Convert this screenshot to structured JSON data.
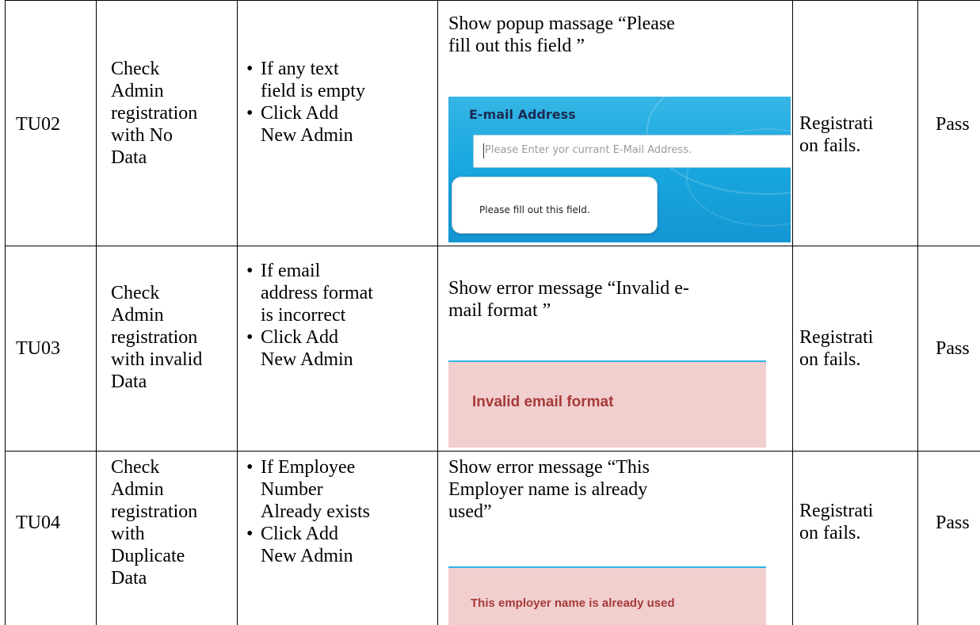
{
  "rows": [
    {
      "id": "TU02",
      "description": "Check\nAdmin\nregistration\nwith  No\nData",
      "steps": [
        "If any text\nfield is empty",
        "Click Add\nNew Admin"
      ],
      "expected": "Show popup massage “Please\nfill out this field ”",
      "screenshot": {
        "field_label": "E-mail Address",
        "placeholder": "Please Enter yor currant E-Mail Address.",
        "popup_text": "Please fill out this field."
      },
      "actual": "Registrati\non fails.",
      "status": "Pass"
    },
    {
      "id": "TU03",
      "description": "Check\nAdmin\nregistration\nwith invalid\nData",
      "steps": [
        "If email\naddress format\nis incorrect",
        "Click Add\nNew Admin"
      ],
      "expected": "Show error message “Invalid e-\nmail format ”",
      "screenshot": {
        "error_text": "Invalid email format"
      },
      "actual": "Registrati\non fails.",
      "status": "Pass"
    },
    {
      "id": "TU04",
      "description": "Check\nAdmin\nregistration\nwith\nDuplicate\nData",
      "steps": [
        "If Employee\nNumber\nAlready exists",
        "Click Add\nNew Admin"
      ],
      "expected": "Show error message “This\nEmployer name is already\nused”",
      "screenshot": {
        "error_text": "This employer name is already used"
      },
      "actual": "Registrati\non fails.",
      "status": "Pass"
    }
  ]
}
